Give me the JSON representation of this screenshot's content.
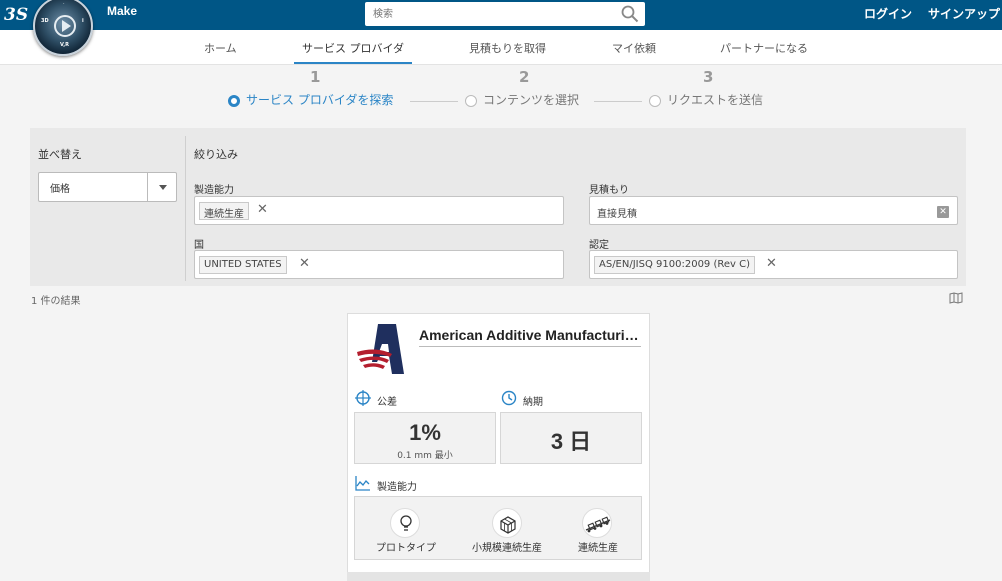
{
  "header": {
    "app_title": "Make",
    "search_placeholder": "検索",
    "login_label": "ログイン",
    "signup_label": "サインアップ"
  },
  "nav": {
    "items": [
      "ホーム",
      "サービス プロバイダ",
      "見積もりを取得",
      "マイ依頼",
      "パートナーになる"
    ],
    "active": "サービス プロバイダ"
  },
  "stepper": {
    "steps": [
      {
        "number": "1",
        "label": "サービス プロバイダを探索",
        "active": true
      },
      {
        "number": "2",
        "label": "コンテンツを選択",
        "active": false
      },
      {
        "number": "3",
        "label": "リクエストを送信",
        "active": false
      }
    ]
  },
  "sort": {
    "label": "並べ替え",
    "value": "価格"
  },
  "filter": {
    "label": "絞り込み",
    "capability": {
      "label": "製造能力",
      "tags": [
        "連続生産"
      ]
    },
    "quote": {
      "label": "見積もり",
      "value": "直接見積"
    },
    "country": {
      "label": "国",
      "tags": [
        "UNITED STATES"
      ]
    },
    "certification": {
      "label": "認定",
      "tags": [
        "AS/EN/JISQ 9100:2009 (Rev C)"
      ]
    }
  },
  "results": {
    "count_text": "1 件の結果"
  },
  "card": {
    "company_name": "American Additive Manufacturing",
    "tolerance_label": "公差",
    "tolerance_value": "1%",
    "tolerance_sub": "0.1 mm 最小",
    "leadtime_label": "納期",
    "leadtime_value": "3 日",
    "capability_label": "製造能力",
    "capabilities": [
      "プロトタイプ",
      "小規模連続生産",
      "連続生産"
    ]
  },
  "colors": {
    "topbar": "#005686",
    "accent": "#2b85c6"
  }
}
